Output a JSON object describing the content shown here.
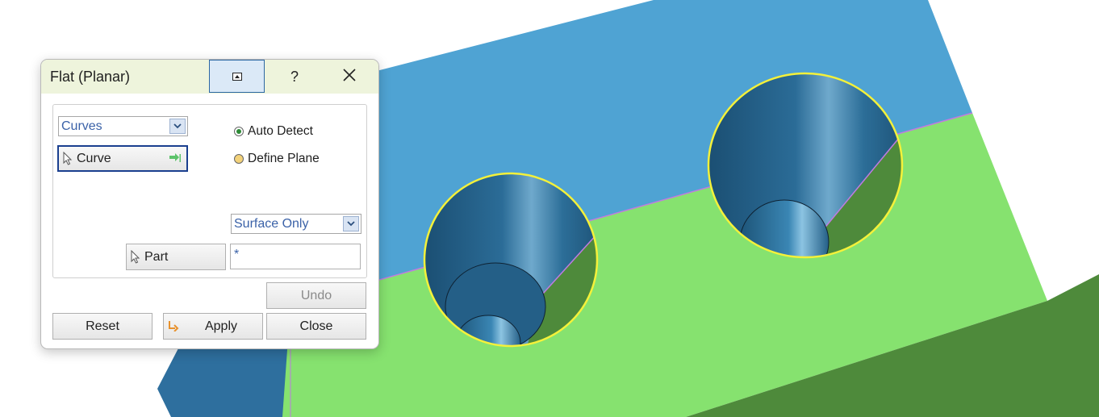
{
  "dialog": {
    "title": "Flat (Planar)",
    "help_label": "?",
    "selection_type": "Curves",
    "curve_button_label": "Curve",
    "radio_options": [
      {
        "label": "Auto Detect",
        "selected": true
      },
      {
        "label": "Define Plane",
        "selected": false
      }
    ],
    "filter_dropdown": "Surface Only",
    "part_button_label": "Part",
    "part_field_value": "*",
    "undo_label": "Undo",
    "reset_label": "Reset",
    "apply_label": "Apply",
    "close_label": "Close"
  },
  "colors": {
    "title_bar": "#eef4dc",
    "top_face": "#4fa3d3",
    "front_face": "#86e26f",
    "side_face": "#4e8a3b",
    "left_face": "#2e6f9e",
    "hole_edge": "#f4f13a",
    "seam_edge": "#c07be0"
  },
  "icons": [
    "collapse-icon",
    "help-icon",
    "close-icon",
    "dropdown-arrow-icon",
    "cursor-icon",
    "next-arrow-icon",
    "apply-arrow-icon"
  ]
}
